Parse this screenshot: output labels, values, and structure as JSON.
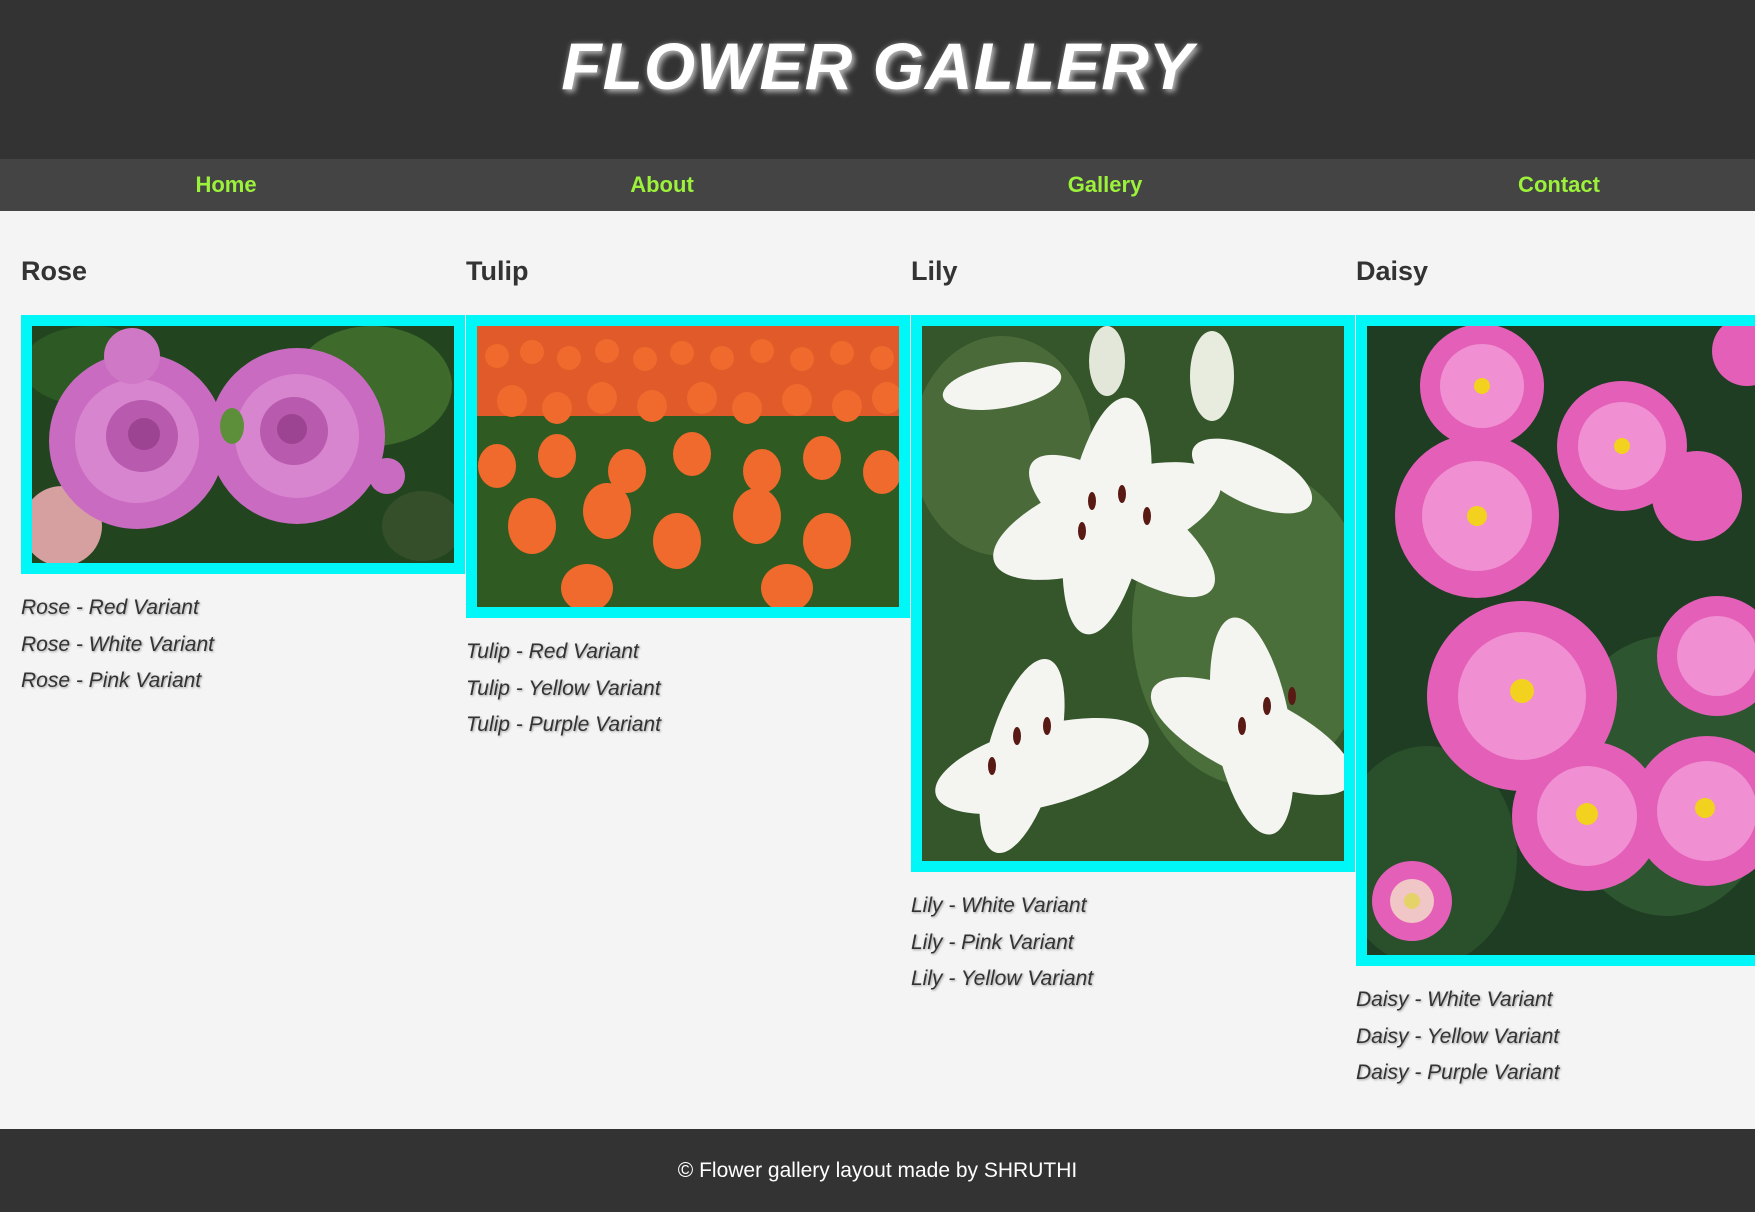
{
  "header": {
    "title": "FLOWER GALLERY"
  },
  "nav": {
    "items": [
      "Home",
      "About",
      "Gallery",
      "Contact"
    ]
  },
  "gallery": [
    {
      "name": "Rose",
      "variants": [
        "Rose - Red Variant",
        "Rose - White Variant",
        "Rose - Pink Variant"
      ]
    },
    {
      "name": "Tulip",
      "variants": [
        "Tulip - Red Variant",
        "Tulip - Yellow Variant",
        "Tulip - Purple Variant"
      ]
    },
    {
      "name": "Lily",
      "variants": [
        "Lily - White Variant",
        "Lily - Pink Variant",
        "Lily - Yellow Variant"
      ]
    },
    {
      "name": "Daisy",
      "variants": [
        "Daisy - White Variant",
        "Daisy - Yellow Variant",
        "Daisy - Purple Variant"
      ]
    }
  ],
  "footer": {
    "text": "© Flower gallery layout made by SHRUTHI"
  },
  "colors": {
    "header_bg": "#333333",
    "nav_bg": "#444444",
    "nav_link": "#9cf23b",
    "page_bg": "#f4f4f4",
    "image_border": "#00f7f7"
  }
}
